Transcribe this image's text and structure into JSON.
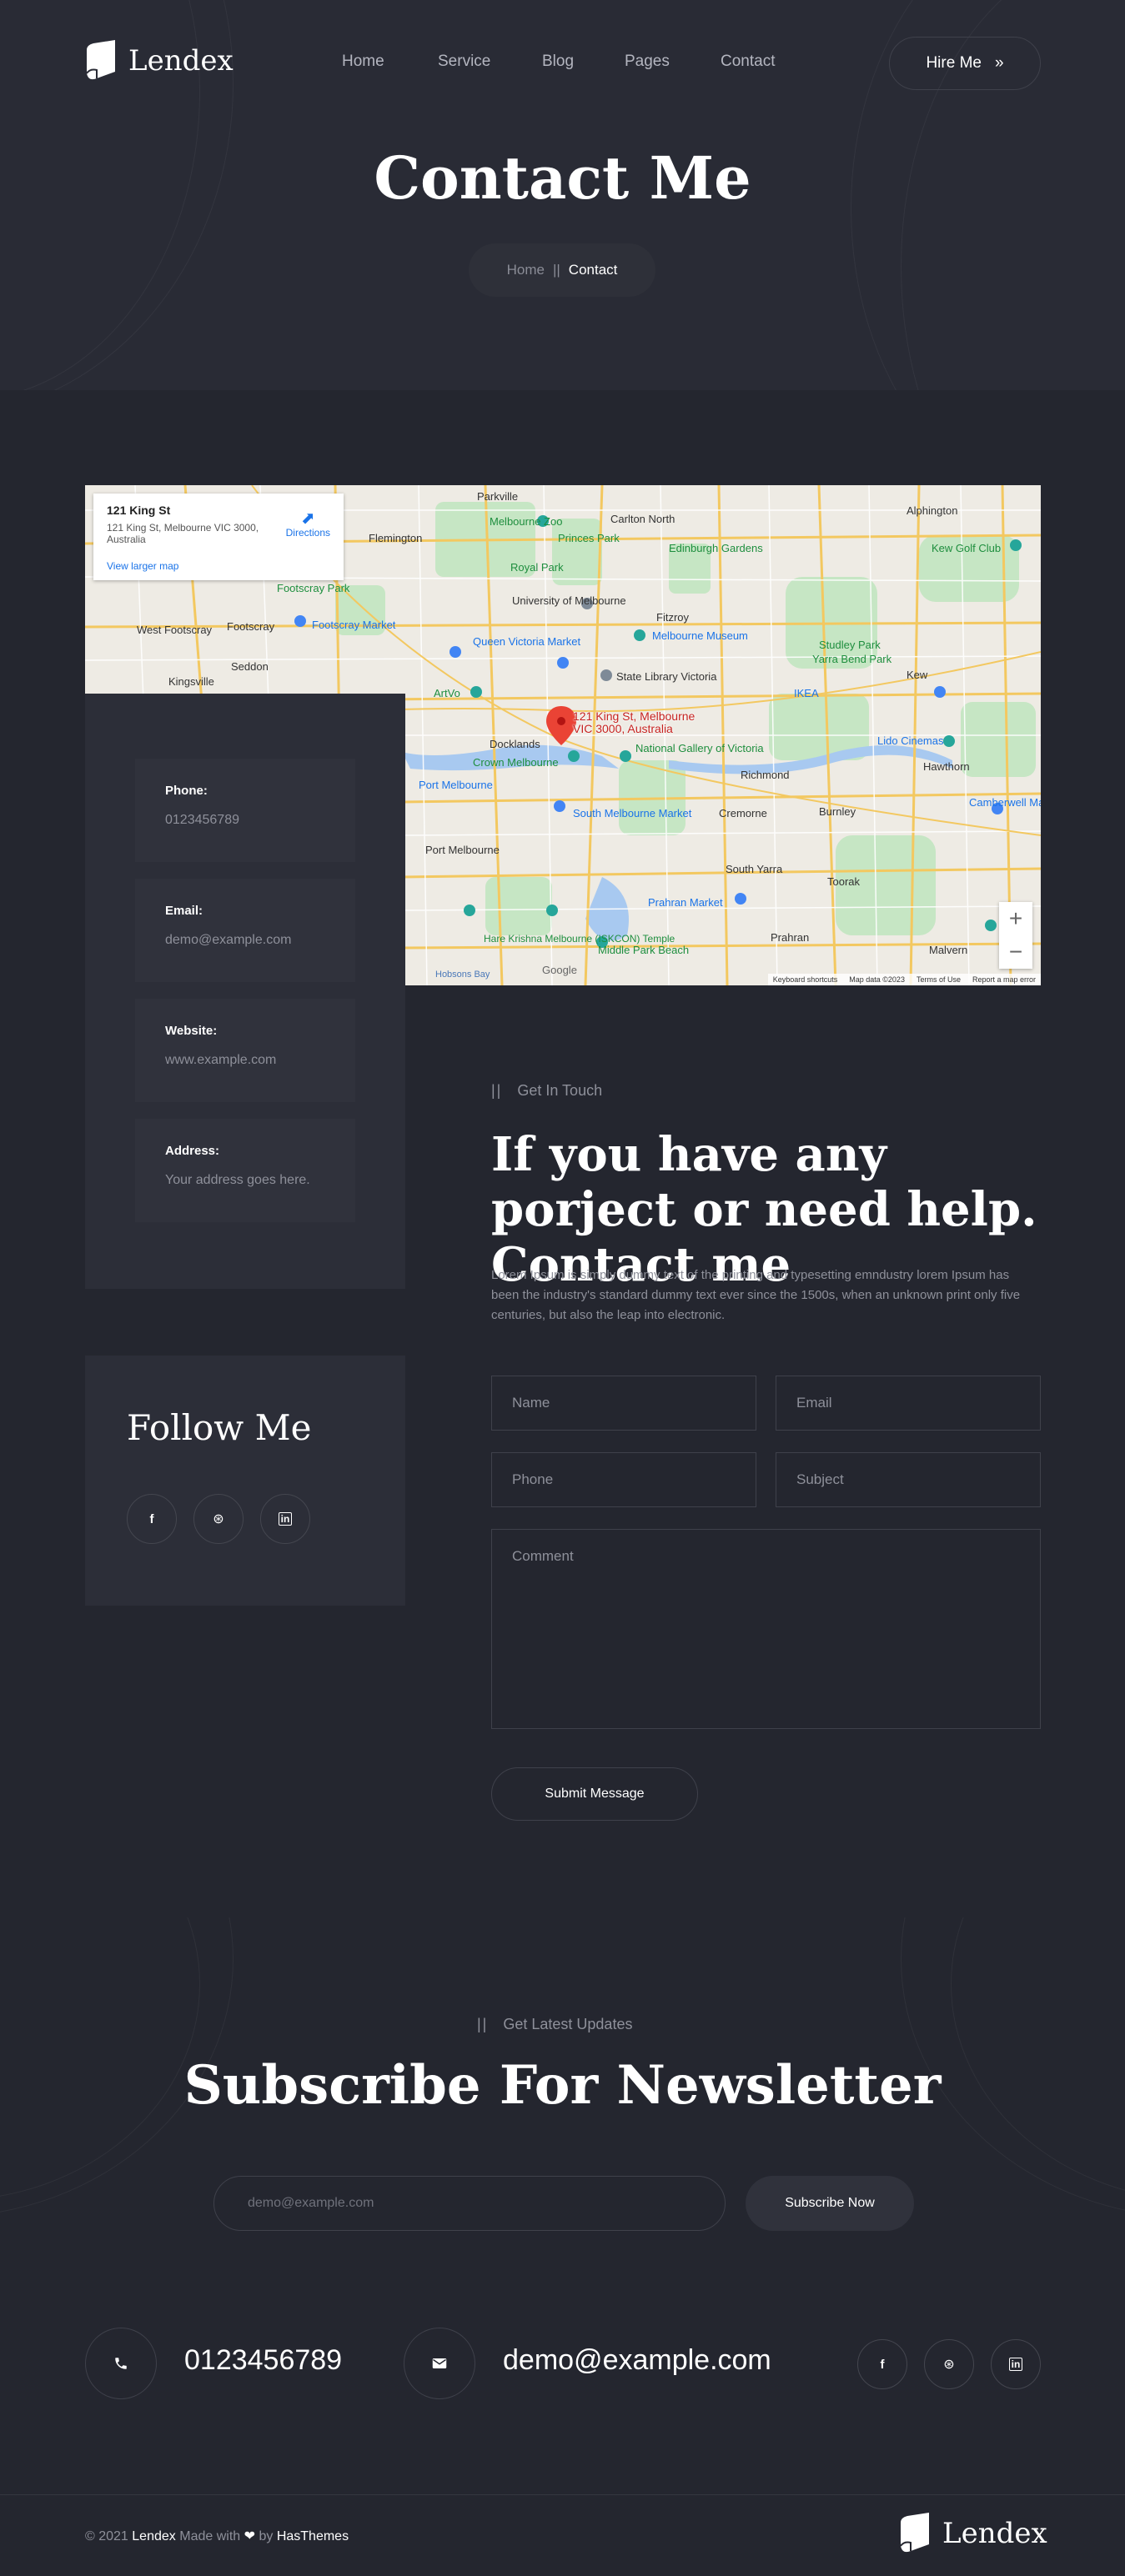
{
  "brand": {
    "name": "Lendex"
  },
  "nav": {
    "items": [
      {
        "label": "Home"
      },
      {
        "label": "Service"
      },
      {
        "label": "Blog"
      },
      {
        "label": "Pages"
      },
      {
        "label": "Contact"
      }
    ],
    "hire_label": "Hire Me",
    "hire_icon": "»"
  },
  "hero": {
    "title": "Contact Me",
    "breadcrumb_home": "Home",
    "breadcrumb_sep": "||",
    "breadcrumb_current": "Contact"
  },
  "map": {
    "place_title": "121 King St",
    "place_address": "121 King St, Melbourne VIC 3000, Australia",
    "directions_label": "Directions",
    "larger_map_label": "View larger map",
    "pin_label": "121 King St, Melbourne VIC 3000, Australia",
    "zoom_in": "+",
    "zoom_out": "−",
    "footer_shortcuts": "Keyboard shortcuts",
    "footer_data": "Map data ©2023",
    "footer_terms": "Terms of Use",
    "footer_report": "Report a map error",
    "labels": [
      "Parkville",
      "Alphington",
      "Flemington",
      "Melbourne Zoo",
      "Carlton North",
      "Princes Park",
      "Edinburgh Gardens",
      "Kew Golf Club",
      "Footscray Park",
      "Royal Park",
      "University of Melbourne",
      "Fitzroy",
      "Yarra Bend Park",
      "West Footscray",
      "Footscray",
      "Footscray Market",
      "Melbourne Museum",
      "Studley Park",
      "Queen Victoria Market",
      "Seddon",
      "Kingsville",
      "State Library Victoria",
      "Kew",
      "Docklands",
      "IKEA",
      "Lido Cinemas",
      "ArtVo",
      "National Gallery of Victoria",
      "Richmond",
      "Hawthorn",
      "Crown Melbourne",
      "Port Melbourne",
      "South Melbourne Market",
      "Cremorne",
      "Burnley",
      "Camberwell Market",
      "Port Melbourne",
      "South Yarra",
      "Toorak",
      "Prahran Market",
      "Prahran",
      "Malvern",
      "Hare Krishna Melbourne (ISKCON) Temple",
      "Middle Park Beach",
      "Hobsons Bay",
      "Google"
    ]
  },
  "contact_info": [
    {
      "label": "Phone:",
      "value": "0123456789"
    },
    {
      "label": "Email:",
      "value": "demo@example.com"
    },
    {
      "label": "Website:",
      "value": "www.example.com"
    },
    {
      "label": "Address:",
      "value": "Your address goes here."
    }
  ],
  "follow": {
    "title": "Follow Me",
    "socials": [
      {
        "icon": "facebook-icon",
        "glyph": "f"
      },
      {
        "icon": "dribbble-icon",
        "glyph": "⊛"
      },
      {
        "icon": "linkedin-icon",
        "glyph": "in"
      }
    ]
  },
  "contact_form": {
    "eyebrow_bars": "||",
    "eyebrow": "Get In Touch",
    "title": "If you have any porject or need help. Contact me",
    "description": "Lorem Ipsum is simply dummy text of the printing and typesetting emndustry lorem Ipsum has been the industry's standard dummy text ever since the 1500s, when an unknown print only five centuries, but also the leap into electronic.",
    "fields": {
      "name": "Name",
      "email": "Email",
      "phone": "Phone",
      "subject": "Subject",
      "comment": "Comment"
    },
    "submit_label": "Submit Message"
  },
  "newsletter": {
    "eyebrow_bars": "||",
    "eyebrow": "Get Latest Updates",
    "title": "Subscribe For Newsletter",
    "placeholder": "demo@example.com",
    "button_label": "Subscribe Now"
  },
  "contact_strip": {
    "phone": "0123456789",
    "email": "demo@example.com"
  },
  "footer": {
    "copy_prefix": "© 2021",
    "brand": "Lendex",
    "made_with": "Made with",
    "heart": "❤",
    "by": "by",
    "author": "HasThemes"
  },
  "colors": {
    "background": "#24262f",
    "hero_bg": "#292b35",
    "panel": "#2c2e38",
    "card": "#30323c",
    "muted_text": "#8e909a",
    "border": "#3f414b"
  }
}
